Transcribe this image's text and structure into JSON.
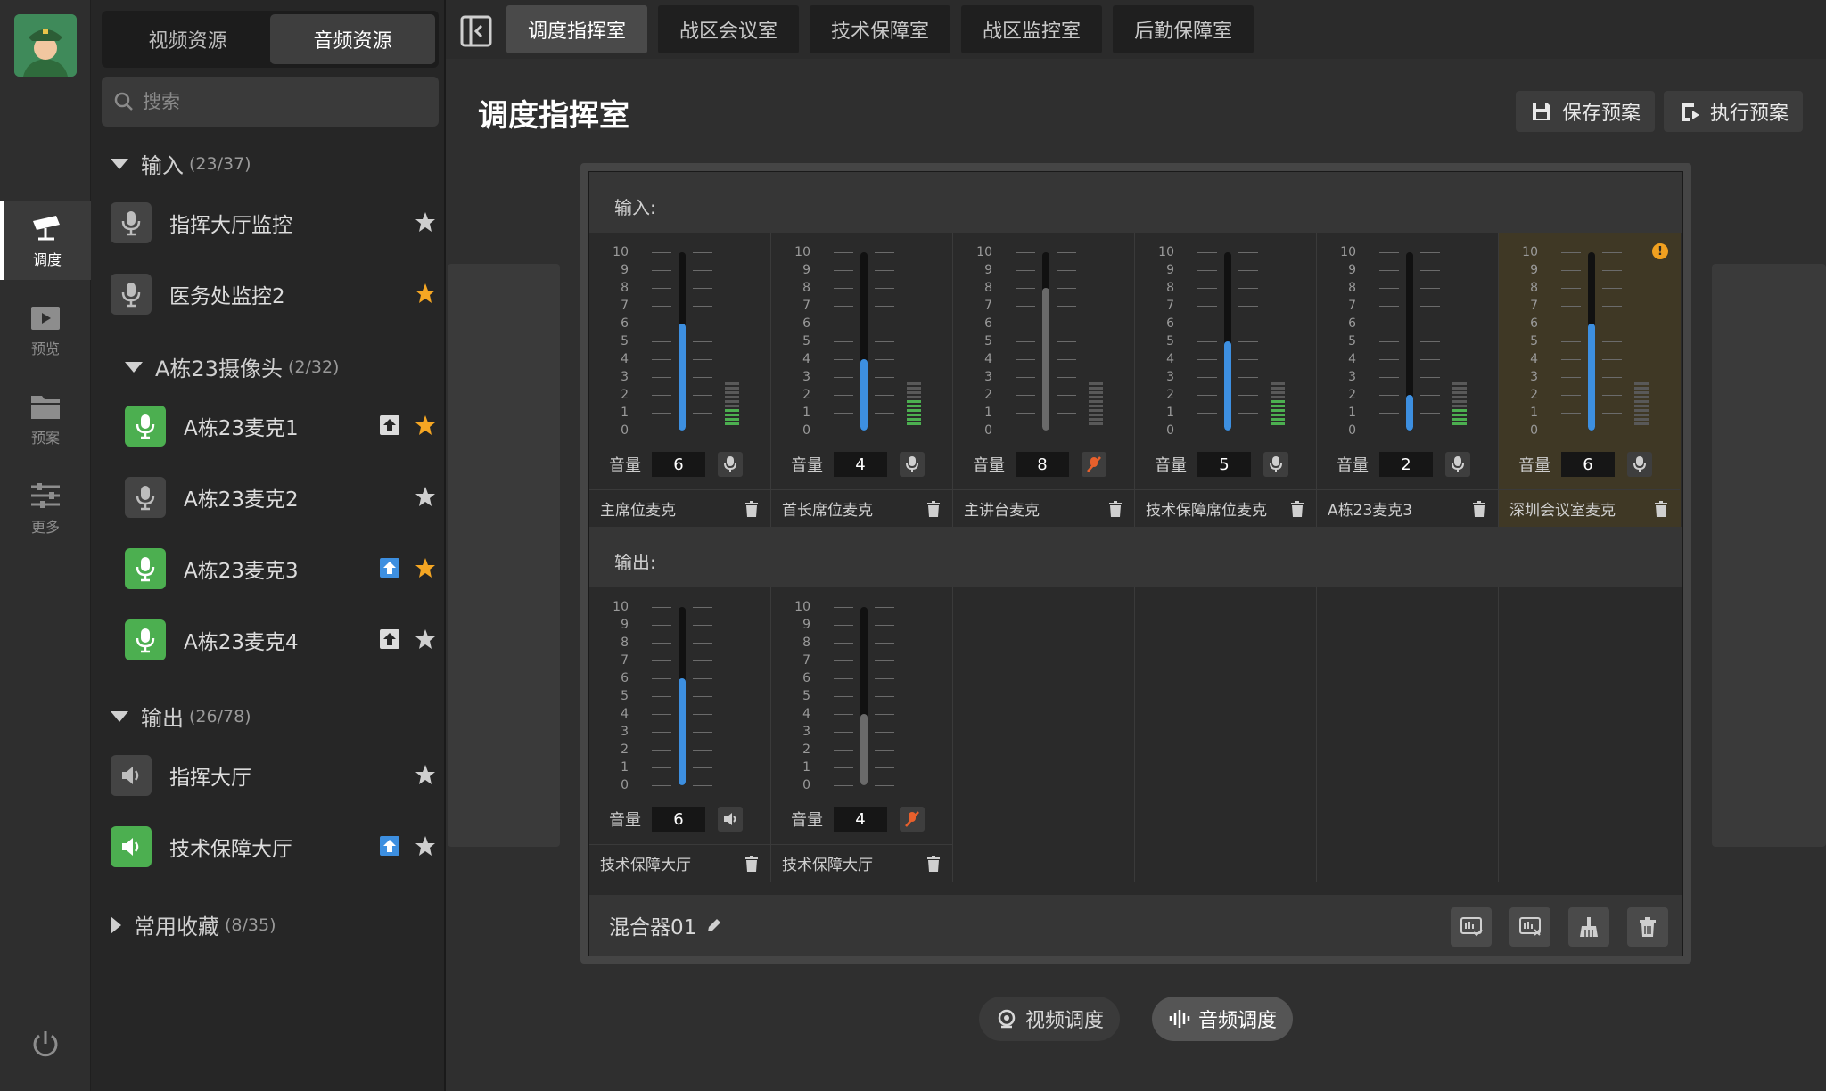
{
  "nav": {
    "items": [
      {
        "label": "调度",
        "icon": "camera-dispatch-icon",
        "active": true
      },
      {
        "label": "预览",
        "icon": "film-icon",
        "active": false
      },
      {
        "label": "预案",
        "icon": "folder-icon",
        "active": false
      },
      {
        "label": "更多",
        "icon": "sliders-icon",
        "active": false
      }
    ],
    "power_icon": "power-icon"
  },
  "resources": {
    "tabs": [
      "视频资源",
      "音频资源"
    ],
    "active_tab": 1,
    "search_placeholder": "搜索",
    "input_group": {
      "label": "输入",
      "count": "(23/37)"
    },
    "input_items": [
      {
        "label": "指挥大厅监控",
        "type": "mic",
        "active": false,
        "starred": false
      },
      {
        "label": "医务处监控2",
        "type": "mic",
        "active": false,
        "starred": true
      }
    ],
    "camera_group": {
      "label": "A栋23摄像头",
      "count": "(2/32)"
    },
    "camera_items": [
      {
        "label": "A栋23麦克1",
        "active": true,
        "upload": "white",
        "starred": true
      },
      {
        "label": "A栋23麦克2",
        "active": false,
        "upload": null,
        "starred": false
      },
      {
        "label": "A栋23麦克3",
        "active": true,
        "upload": "blue",
        "starred": true
      },
      {
        "label": "A栋23麦克4",
        "active": true,
        "upload": "white",
        "starred": false
      }
    ],
    "output_group": {
      "label": "输出",
      "count": "(26/78)"
    },
    "output_items": [
      {
        "label": "指挥大厅",
        "active": false,
        "upload": null,
        "starred": false
      },
      {
        "label": "技术保障大厅",
        "active": true,
        "upload": "blue",
        "starred": false
      }
    ],
    "favorites_group": {
      "label": "常用收藏",
      "count": "(8/35)"
    }
  },
  "rooms": {
    "tabs": [
      "调度指挥室",
      "战区会议室",
      "技术保障室",
      "战区监控室",
      "后勤保障室"
    ],
    "active": 0
  },
  "page": {
    "title": "调度指挥室",
    "save_label": "保存预案",
    "exec_label": "执行预案"
  },
  "mixer": {
    "input_label": "输入:",
    "output_label": "输出:",
    "volume_label": "音量",
    "scale": [
      "10",
      "9",
      "8",
      "7",
      "6",
      "5",
      "4",
      "3",
      "2",
      "1",
      "0"
    ],
    "inputs": [
      {
        "name": "主席位麦克",
        "volume": "6",
        "level": 6,
        "muted": false,
        "meter": 4,
        "warning": false
      },
      {
        "name": "首长席位麦克",
        "volume": "4",
        "level": 4,
        "muted": false,
        "meter": 6,
        "warning": false
      },
      {
        "name": "主讲台麦克",
        "volume": "8",
        "level": 8,
        "muted": true,
        "meter": 0,
        "warning": false
      },
      {
        "name": "技术保障席位麦克",
        "volume": "5",
        "level": 5,
        "muted": false,
        "meter": 6,
        "warning": false
      },
      {
        "name": "A栋23麦克3",
        "volume": "2",
        "level": 2,
        "muted": false,
        "meter": 4,
        "warning": false
      },
      {
        "name": "深圳会议室麦克",
        "volume": "6",
        "level": 6,
        "muted": false,
        "meter": 0,
        "warning": true
      }
    ],
    "outputs": [
      {
        "name": "技术保障大厅",
        "volume": "6",
        "level": 6,
        "muted": false
      },
      {
        "name": "技术保障大厅",
        "volume": "4",
        "level": 4,
        "muted": true
      }
    ],
    "name": "混合器01",
    "footer_icons": [
      "monitor-check-icon",
      "monitor-close-icon",
      "broom-icon",
      "trash-icon"
    ]
  },
  "modes": {
    "video_label": "视频调度",
    "audio_label": "音频调度",
    "active": "audio"
  },
  "colors": {
    "accent_blue": "#3d8fe0",
    "active_green": "#4caf50",
    "star_orange": "#f5a623",
    "mute_orange": "#e8602c",
    "warning": "#f0a020"
  }
}
